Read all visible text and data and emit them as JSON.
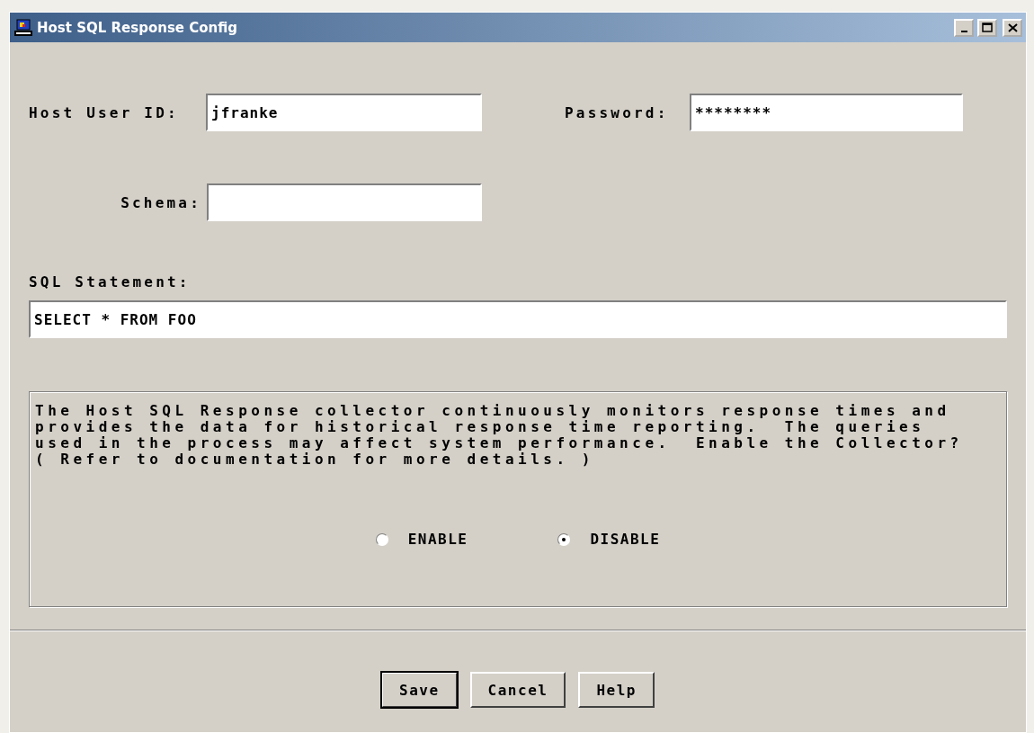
{
  "window": {
    "title": "Host SQL Response Config"
  },
  "fields": [
    {
      "label": "Host User ID:",
      "value": "jfranke"
    },
    {
      "label": "Password:",
      "value": "********"
    },
    {
      "label": "Schema:"
    }
  ],
  "sql": {
    "label": "SQL Statement:",
    "value": "SELECT * FROM FOO"
  },
  "notice": "The Host SQL Response collector continuously monitors response times and\nprovides the data for historical response time reporting.  The queries\nused in the process may affect system performance.  Enable the Collector?\n( Refer to documentation for more details. )",
  "options": [
    {
      "label": "ENABLE",
      "selected": false
    },
    {
      "label": "DISABLE",
      "selected": true
    }
  ],
  "buttons": [
    {
      "label": "Save",
      "default": true
    },
    {
      "label": "Cancel",
      "default": false
    },
    {
      "label": "Help",
      "default": false
    }
  ]
}
